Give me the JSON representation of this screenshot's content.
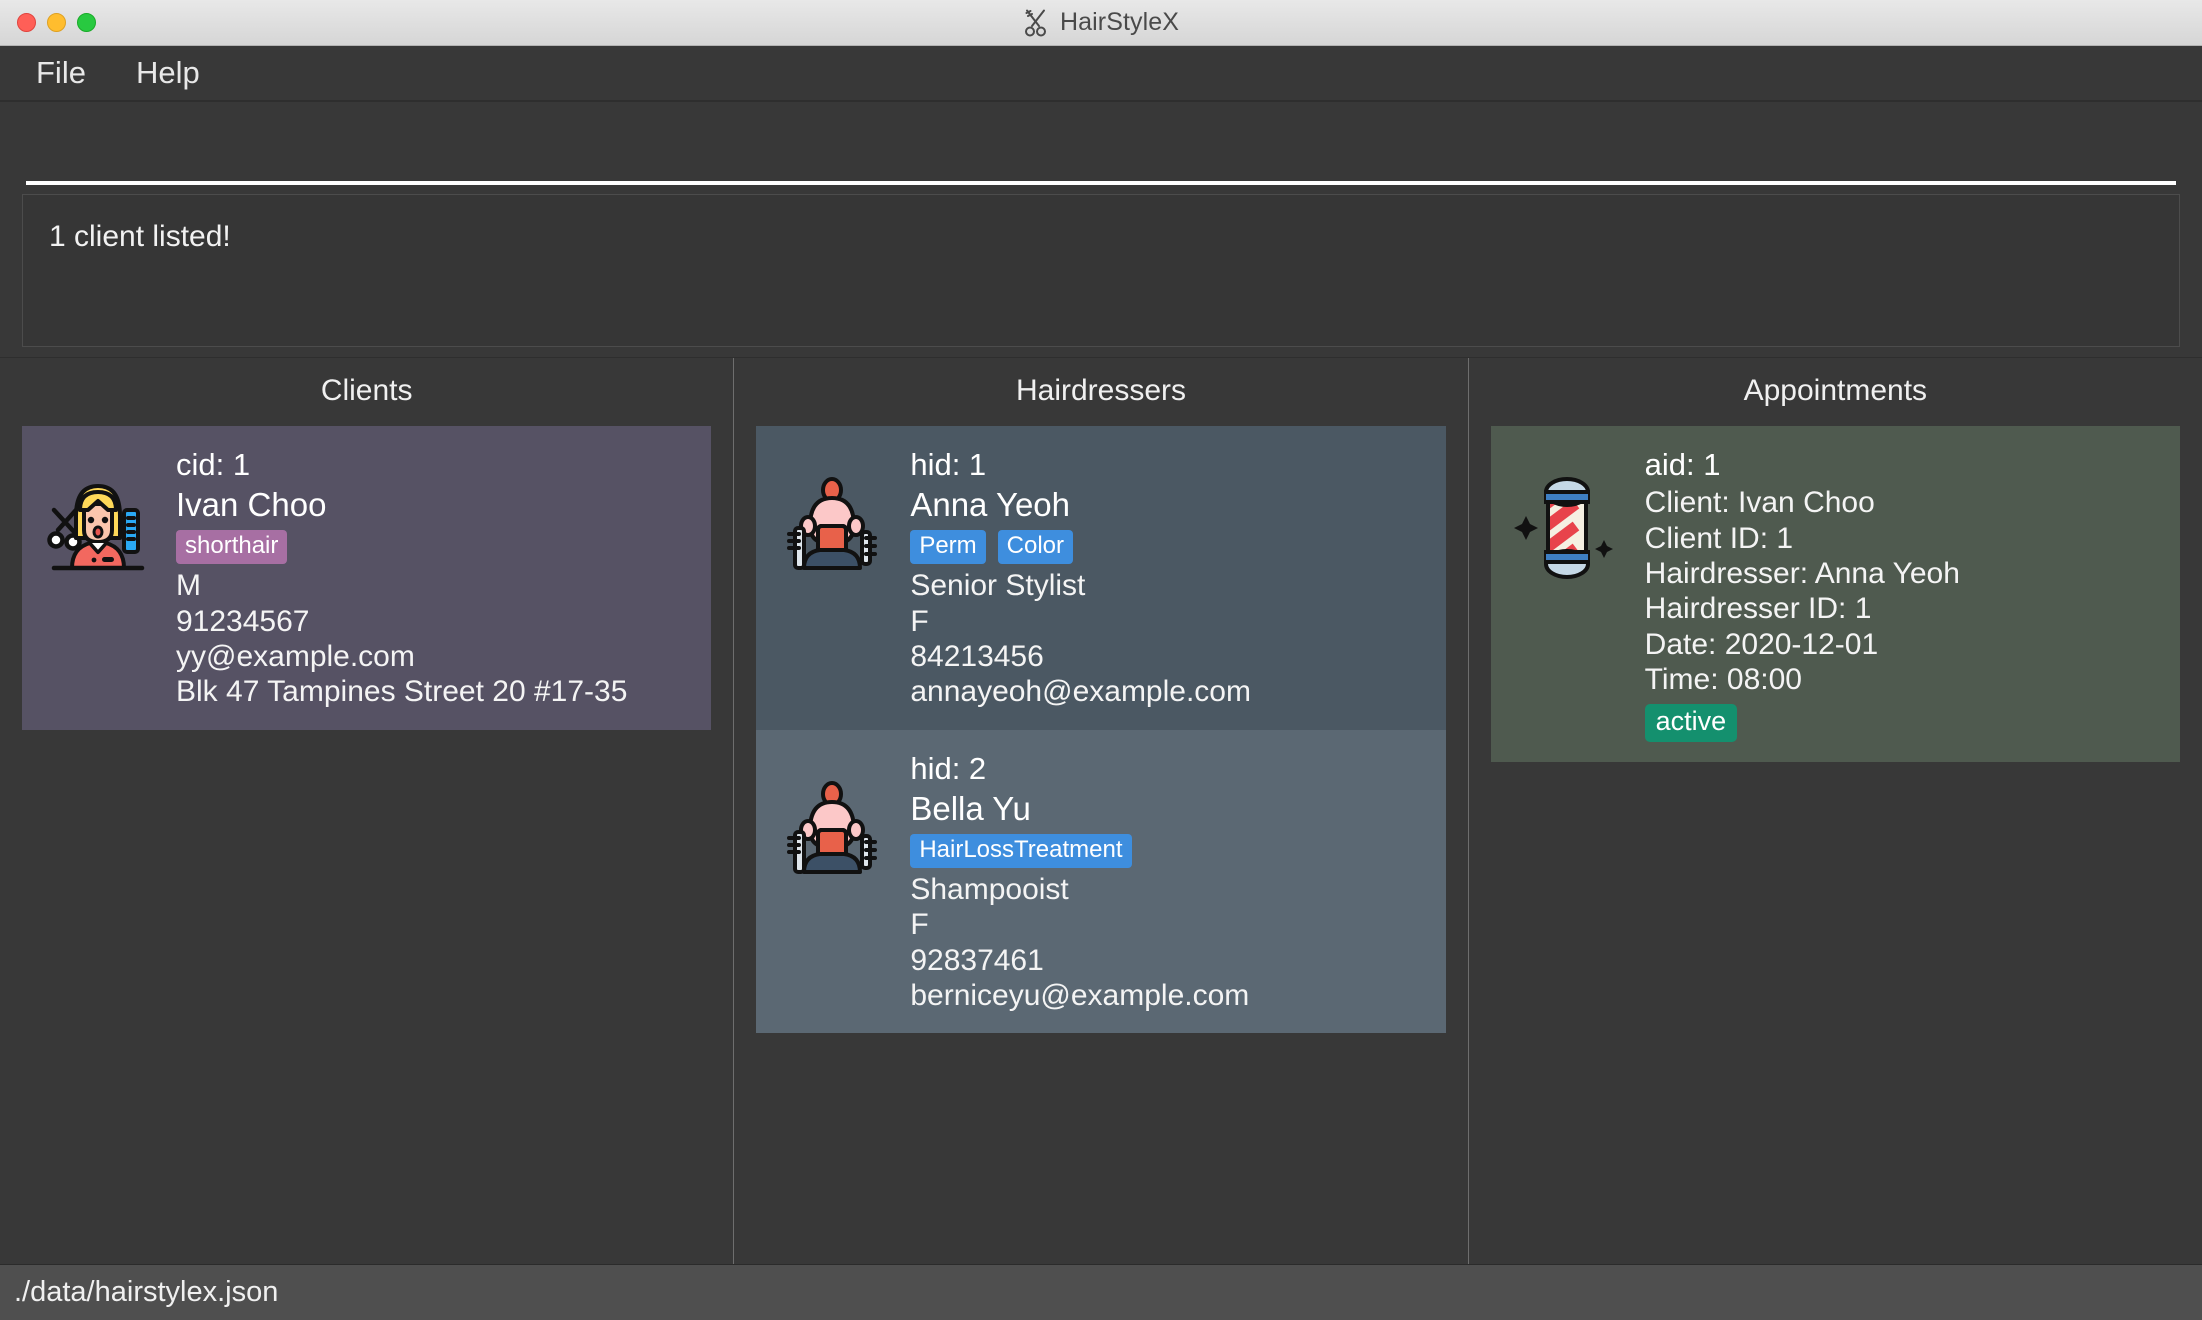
{
  "window": {
    "title": "HairStyleX",
    "title_icon": "scissors-icon",
    "traffic_lights": [
      "close-button",
      "minimize-button",
      "maximize-button"
    ]
  },
  "menubar": {
    "items": [
      {
        "label": "File"
      },
      {
        "label": "Help"
      }
    ]
  },
  "command": {
    "value": "",
    "placeholder": ""
  },
  "result": {
    "text": "1 client listed!"
  },
  "panels": {
    "clients": {
      "title": "Clients",
      "avatar_icon": "client-hairstyle-icon",
      "cards": [
        {
          "id_label": "cid: 1",
          "name": "Ivan Choo",
          "tags": [
            {
              "text": "shorthair",
              "color": "#a76fa3"
            }
          ],
          "gender": "M",
          "phone": "91234567",
          "email": "yy@example.com",
          "address": "Blk 47 Tampines Street 20 #17-35"
        }
      ]
    },
    "hairdressers": {
      "title": "Hairdressers",
      "avatar_icon": "hairdresser-barber-icon",
      "cards": [
        {
          "id_label": "hid: 1",
          "name": "Anna Yeoh",
          "tags": [
            {
              "text": "Perm",
              "color": "#3e8ede"
            },
            {
              "text": "Color",
              "color": "#3e8ede"
            }
          ],
          "title": "Senior Stylist",
          "gender": "F",
          "phone": "84213456",
          "email": "annayeoh@example.com"
        },
        {
          "id_label": "hid: 2",
          "name": "Bella Yu",
          "tags": [
            {
              "text": "HairLossTreatment",
              "color": "#3e8ede"
            }
          ],
          "title": "Shampooist",
          "gender": "F",
          "phone": "92837461",
          "email": "berniceyu@example.com"
        }
      ]
    },
    "appointments": {
      "title": "Appointments",
      "avatar_icon": "barber-pole-icon",
      "cards": [
        {
          "id_label": "aid: 1",
          "client": "Client: Ivan Choo",
          "client_id": "Client ID: 1",
          "hairdresser": "Hairdresser: Anna Yeoh",
          "hairdresser_id": "Hairdresser ID: 1",
          "date": "Date: 2020-12-01",
          "time": "Time: 08:00",
          "status": {
            "text": "active",
            "color": "#14906e"
          }
        }
      ]
    }
  },
  "statusbar": {
    "path": "./data/hairstylex.json"
  },
  "colors": {
    "app_bg": "#383838",
    "client_card": "#565264",
    "hairdresser_card_a": "#4b5863",
    "hairdresser_card_b": "#5b6873",
    "appointment_card": "#4f5a4f",
    "tag_blue": "#3e8ede",
    "tag_purple": "#a76fa3",
    "badge_green": "#14906e",
    "statusbar": "#4f4f4f"
  }
}
